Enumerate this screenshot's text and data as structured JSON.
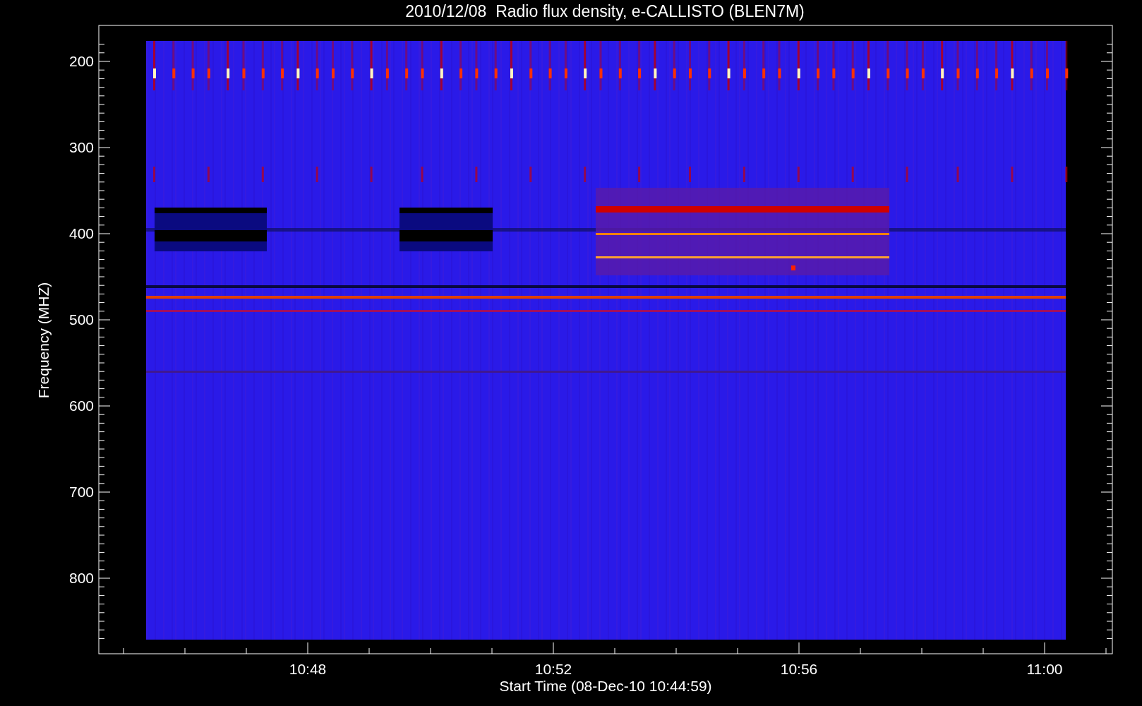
{
  "title": "2010/12/08  Radio flux density, e-CALLISTO (BLEN7M)",
  "y_axis": {
    "label": "Frequency (MHZ)",
    "ticks": [
      "200",
      "300",
      "400",
      "500",
      "600",
      "700",
      "800"
    ]
  },
  "x_axis": {
    "label": "Start Time (08-Dec-10 10:44:59)",
    "ticks": [
      "10:48",
      "10:52",
      "10:56",
      "11:00"
    ]
  }
}
